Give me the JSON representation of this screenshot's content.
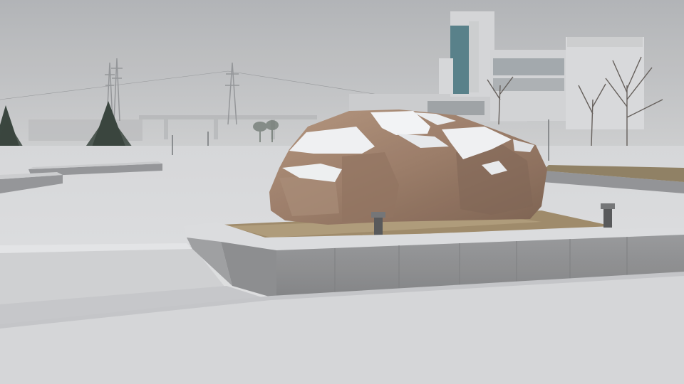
{
  "scene": {
    "subject": "snow-covered-boulder-in-plaza",
    "weather": "snow-and-haze",
    "palette": {
      "sky": "#c3c4c6",
      "sky_top": "#aeb0b3",
      "snow_ground": "#d9dadc",
      "snow_shadow": "#bfc1c4",
      "rock": "#9a7a64",
      "rock_dark": "#6f5545",
      "rock_light": "#b59680",
      "stone_wall": "#8e8f91",
      "stone_wall_dark": "#6c6d6f",
      "building_white": "#d5d6d8",
      "building_glass": "#4f7a83",
      "tree_dark": "#2e3b33",
      "soil": "#8a7355"
    }
  }
}
